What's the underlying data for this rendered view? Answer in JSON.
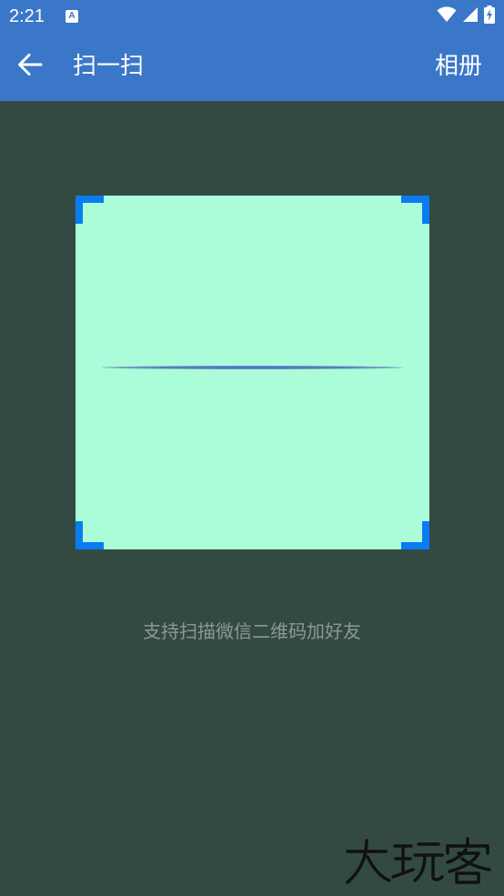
{
  "status_bar": {
    "time": "2:21",
    "notification_icon": "A",
    "icons": [
      "wifi-icon",
      "signal-icon",
      "battery-charging-icon"
    ]
  },
  "app_bar": {
    "back_icon": "arrow-left-icon",
    "title": "扫一扫",
    "album_label": "相册"
  },
  "scanner": {
    "hint": "支持扫描微信二维码加好友"
  },
  "watermark": {
    "text": "大玩客"
  },
  "colors": {
    "app_bar": "#3a77c8",
    "background": "#334a42",
    "scan_area": "#abfdd9",
    "corner": "#0a7cf0",
    "scan_line": "#3b7ad6",
    "hint_text": "#8a9a93"
  }
}
